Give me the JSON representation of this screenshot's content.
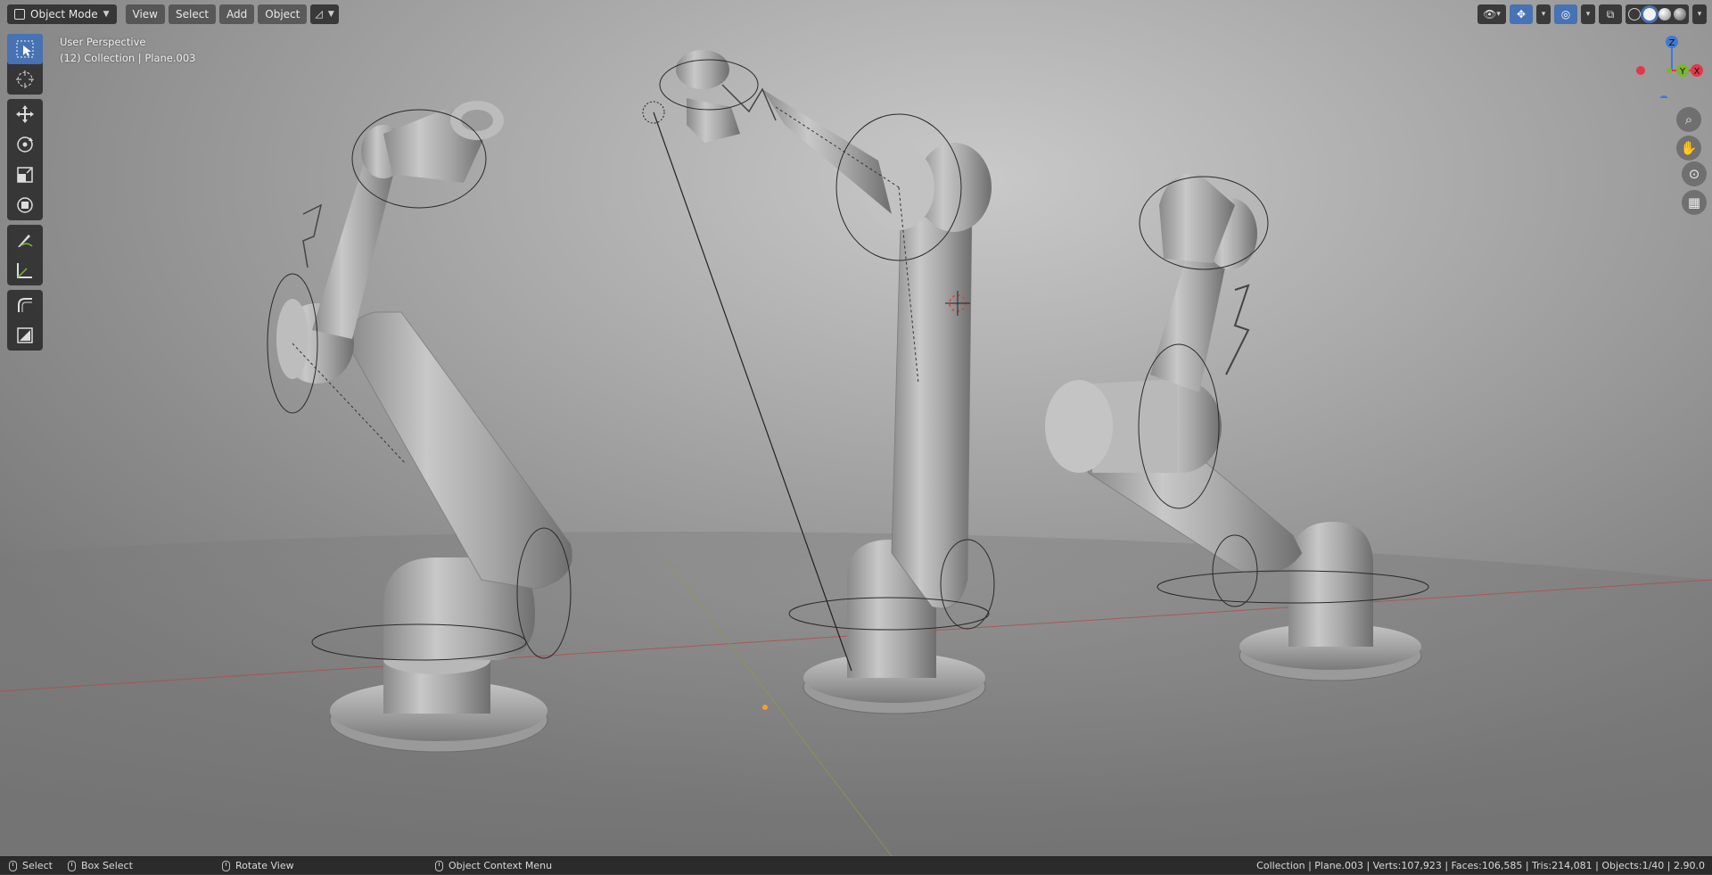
{
  "header": {
    "mode": "Object Mode",
    "menus": [
      "View",
      "Select",
      "Add",
      "Object"
    ]
  },
  "viewport": {
    "perspective": "User Perspective",
    "collection_info": "(12) Collection | Plane.003"
  },
  "gizmo": {
    "axis_z": "Z",
    "axis_y": "Y",
    "axis_x": "X",
    "colors": {
      "x": "#e0394a",
      "y": "#7bb531",
      "z": "#3f79d6"
    }
  },
  "toolbar": {
    "tools": [
      "select-box",
      "cursor",
      "move",
      "rotate",
      "scale",
      "transform",
      "annotate",
      "measure",
      "extrude",
      "add-cube"
    ]
  },
  "statusbar": {
    "select": "Select",
    "box_select": "Box Select",
    "rotate_view": "Rotate View",
    "context_menu": "Object Context Menu",
    "stats": "Collection | Plane.003 | Verts:107,923 | Faces:106,585 | Tris:214,081 | Objects:1/40 | 2.90.0"
  },
  "colors": {
    "accent": "#4772b3",
    "header_bg": "#282828",
    "status_bg": "#2b2b2b"
  }
}
